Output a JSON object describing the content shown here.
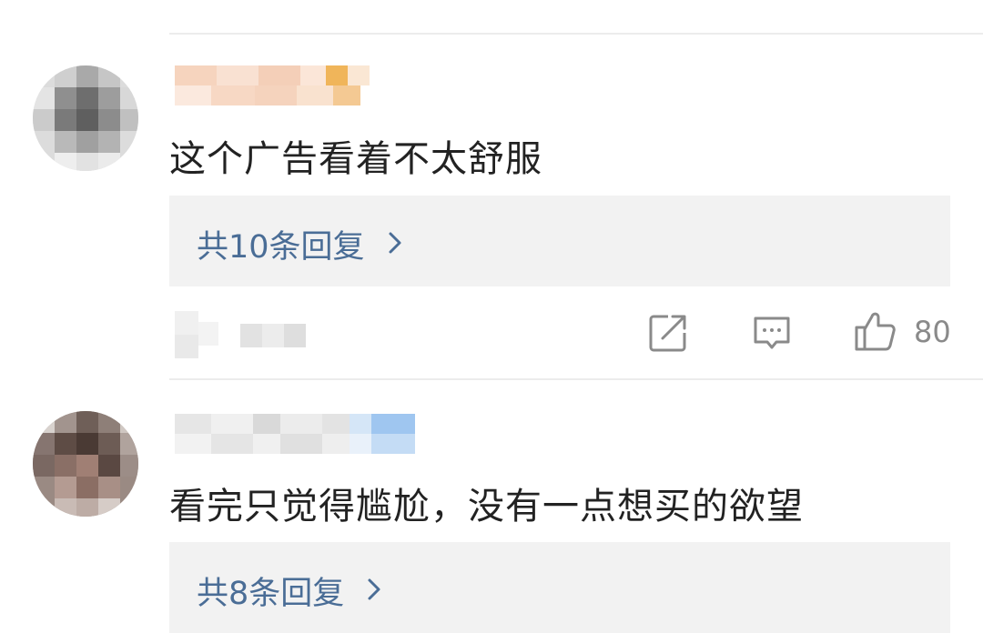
{
  "comments": [
    {
      "username": "",
      "text": "这个广告看着不太舒服",
      "reply_label": "共10条回复",
      "like_count": "80"
    },
    {
      "username": "",
      "text": "看完只觉得尴尬，没有一点想买的欲望",
      "reply_label": "共8条回复",
      "like_count": ""
    }
  ],
  "icons": {
    "share": "share-icon",
    "comment": "comment-icon",
    "like": "thumbs-up-icon",
    "chevron": "chevron-right-icon"
  },
  "colors": {
    "reply_link": "#4a6d96",
    "reply_background": "#f2f2f2",
    "icon_gray": "#8a8a8a",
    "divider": "#ececec"
  }
}
